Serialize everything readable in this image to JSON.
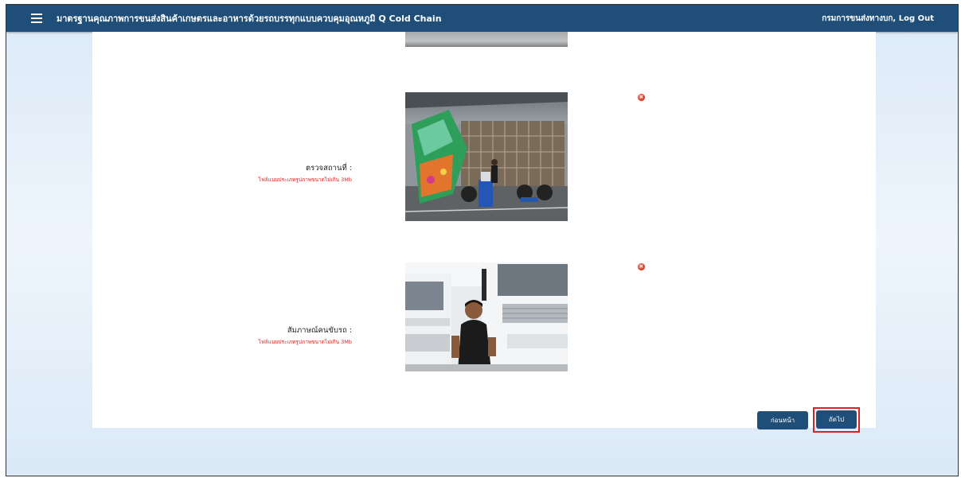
{
  "header": {
    "menu_icon": "hamburger-icon",
    "title": "มาตรฐานคุณภาพการขนส่งสินค้าเกษตรและอาหารด้วยรถบรรทุกแบบควบคุมอุณหภูมิ Q Cold Chain",
    "user": "กรมการขนส่งทางบก, Log Out"
  },
  "rows": [
    {
      "label": "ตรวจสถานที่ :",
      "hint": "ไฟล์แนบประเภทรูปภาพขนาดไม่เกิน 3Mb",
      "delete_icon": "delete-icon"
    },
    {
      "label": "สัมภาษณ์คนขับรถ :",
      "hint": "ไฟล์แนบประเภทรูปภาพขนาดไม่เกิน 3Mb",
      "delete_icon": "delete-icon"
    }
  ],
  "footer": {
    "prev_label": "ก่อนหน้า",
    "next_label": "ถัดไป"
  },
  "colors": {
    "header_bg": "#1f4e79",
    "button_bg": "#1f4e79",
    "highlight": "#e02020",
    "hint_text": "#e02020"
  }
}
